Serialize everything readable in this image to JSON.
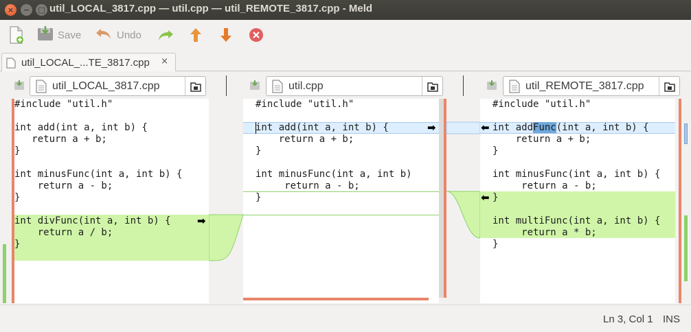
{
  "window": {
    "title": "util_LOCAL_3817.cpp — util.cpp — util_REMOTE_3817.cpp - Meld"
  },
  "toolbar": {
    "save_label": "Save",
    "undo_label": "Undo"
  },
  "tab": {
    "label": "util_LOCAL_...TE_3817.cpp",
    "close": "×"
  },
  "files": {
    "left": "util_LOCAL_3817.cpp",
    "middle": "util.cpp",
    "right": "util_REMOTE_3817.cpp"
  },
  "panes": {
    "left": [
      "#include \"util.h\"",
      "",
      "int add(int a, int b) {",
      "   return a + b;",
      "}",
      "",
      "int minusFunc(int a, int b) {",
      "    return a - b;",
      "}",
      "",
      "int divFunc(int a, int b) {",
      "    return a / b;",
      "}"
    ],
    "middle": [
      "#include \"util.h\"",
      "",
      "int add(int a, int b) {",
      "    return a + b;",
      "}",
      "",
      "int minusFunc(int a, int b)",
      "     return a - b;",
      "}"
    ],
    "right": {
      "line0": "#include \"util.h\"",
      "line2_pre": "int add",
      "line2_hl": "Func",
      "line2_post": "(int a, int b) {",
      "line3": "    return a + b;",
      "line4": "}",
      "line6": "int minusFunc(int a, int b) {",
      "line7": "     return a - b;",
      "line8": "}",
      "line10": "int multiFunc(int a, int b) {",
      "line11": "     return a * b;",
      "line12": "}"
    }
  },
  "status": {
    "position": "Ln 3, Col 1",
    "mode": "INS"
  },
  "colors": {
    "changed": "#ddeeff",
    "inserted": "#d0f5a9",
    "conflict_ruler": "#e8856a"
  }
}
